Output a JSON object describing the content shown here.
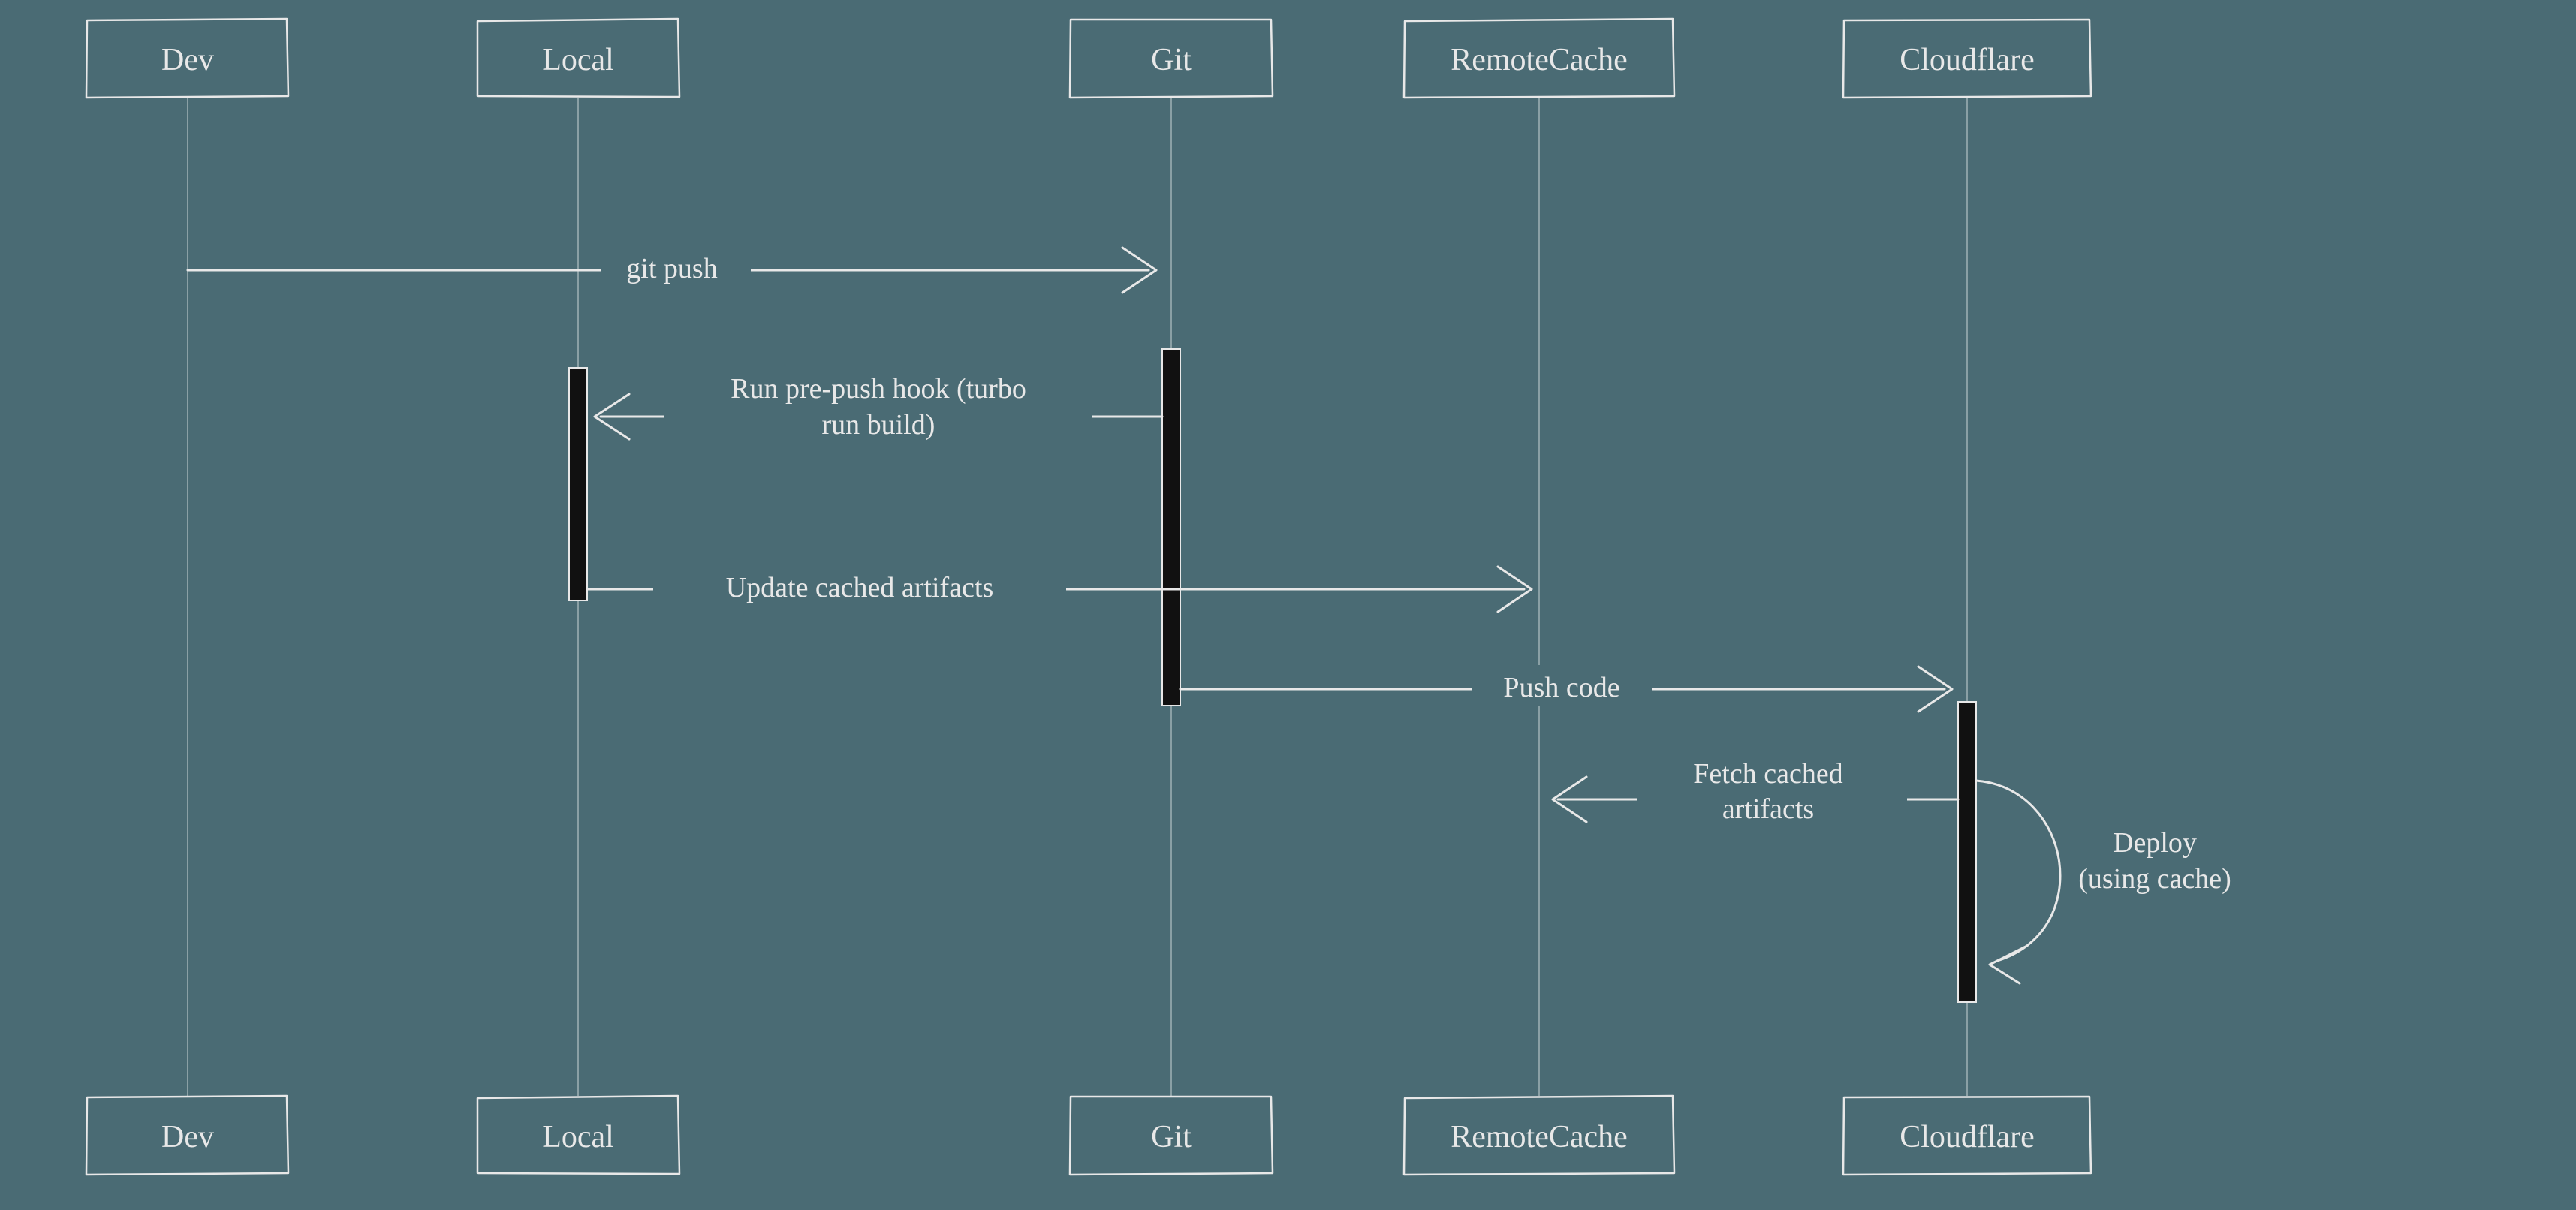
{
  "diagram": {
    "type": "sequence",
    "participants": [
      {
        "id": "dev",
        "label": "Dev"
      },
      {
        "id": "local",
        "label": "Local"
      },
      {
        "id": "git",
        "label": "Git"
      },
      {
        "id": "remote_cache",
        "label": "RemoteCache"
      },
      {
        "id": "cloudflare",
        "label": "Cloudflare"
      }
    ],
    "messages": {
      "m1": {
        "from": "dev",
        "to": "git",
        "label": "git push"
      },
      "m2": {
        "from": "git",
        "to": "local",
        "label": "Run pre-push hook (turbo run build)"
      },
      "m3": {
        "from": "local",
        "to": "remote_cache",
        "label": "Update cached artifacts"
      },
      "m4": {
        "from": "git",
        "to": "cloudflare",
        "label": "Push code"
      },
      "m5": {
        "from": "cloudflare",
        "to": "remote_cache",
        "label": "Fetch cached artifacts"
      },
      "m6": {
        "from": "cloudflare",
        "to": "cloudflare",
        "label": "Deploy (using cache)"
      }
    }
  }
}
